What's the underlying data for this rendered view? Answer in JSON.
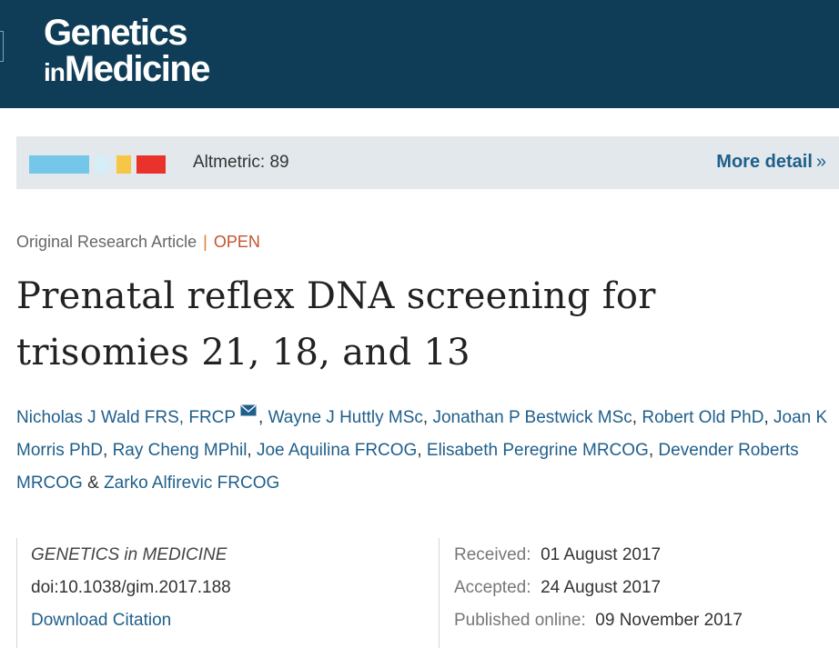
{
  "header": {
    "logo_line1": "Genetics",
    "logo_in": "in",
    "logo_line2": "Medicine"
  },
  "altmetric": {
    "score_text": "Altmetric: 89",
    "more_detail": "More detail",
    "donut_colors": [
      "#74c7e8",
      "#d6eef7",
      "#f6c744",
      "#e8322b"
    ]
  },
  "article": {
    "type_label": "Original Research Article",
    "separator": "|",
    "access": "OPEN",
    "title": "Prenatal reflex DNA screening for trisomies 21, 18, and 13"
  },
  "authors": [
    "Nicholas J Wald FRS, FRCP",
    "Wayne J Huttly MSc",
    "Jonathan P Bestwick MSc",
    "Robert Old PhD",
    "Joan K Morris PhD",
    "Ray Cheng MPhil",
    "Joe Aquilina FRCOG",
    "Elisabeth Peregrine MRCOG",
    "Devender Roberts MRCOG",
    "Zarko Alfirevic FRCOG"
  ],
  "author_connector": "&",
  "info": {
    "journal": "GENETICS in MEDICINE",
    "doi": "doi:10.1038/gim.2017.188",
    "download": "Download Citation",
    "received_label": "Received:",
    "received_date": "01 August 2017",
    "accepted_label": "Accepted:",
    "accepted_date": "24 August 2017",
    "published_label": "Published online:",
    "published_date": "09 November 2017"
  }
}
